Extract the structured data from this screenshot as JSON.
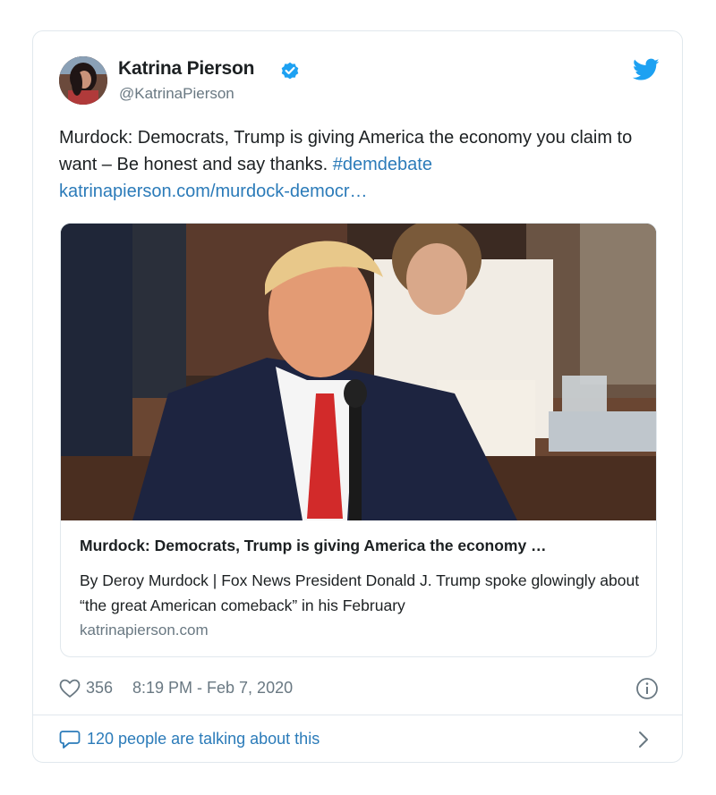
{
  "author": {
    "name": "Katrina Pierson",
    "handle": "@KatrinaPierson",
    "verified": true
  },
  "tweet": {
    "text": "Murdock: Democrats, Trump is giving America the economy you claim to want – Be honest and say thanks.",
    "hashtag": "#demdebate",
    "link": "katrinapierson.com/murdock-democr…"
  },
  "link_card": {
    "title": "Murdock: Democrats, Trump is giving America the economy …",
    "description": "By Deroy Murdock | Fox News President Donald J. Trump spoke glowingly about “the great American comeback” in his February",
    "domain": "katrinapierson.com"
  },
  "stats": {
    "likes": "356",
    "timestamp": "8:19 PM - Feb 7, 2020"
  },
  "conversation": {
    "label": "120 people are talking about this"
  },
  "colors": {
    "accent": "#1da1f2",
    "link": "#2b7bb9",
    "muted": "#697882",
    "border": "#e1e8ed"
  },
  "icons": [
    "verified-icon",
    "twitter-bird-icon",
    "heart-icon",
    "info-icon",
    "comment-icon",
    "chevron-right-icon"
  ]
}
